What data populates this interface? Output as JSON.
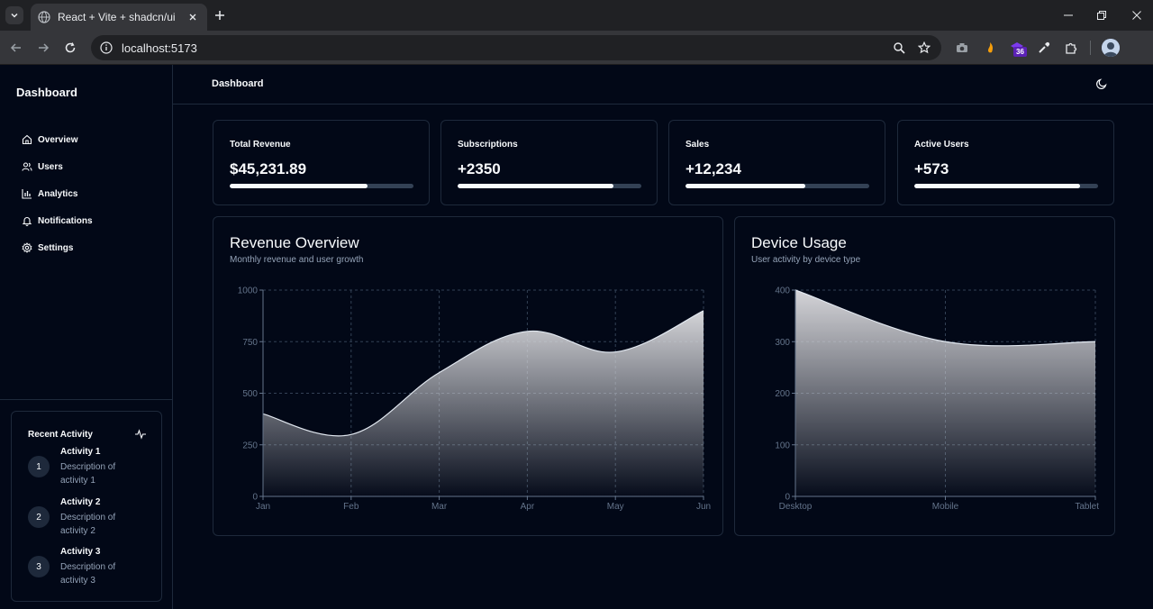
{
  "browser": {
    "tab_title": "React + Vite + shadcn/ui",
    "url": "localhost:5173",
    "extension_badge": "36"
  },
  "sidebar": {
    "title": "Dashboard",
    "items": [
      {
        "label": "Overview",
        "icon": "home-icon"
      },
      {
        "label": "Users",
        "icon": "users-icon"
      },
      {
        "label": "Analytics",
        "icon": "bar-chart-icon"
      },
      {
        "label": "Notifications",
        "icon": "bell-icon"
      },
      {
        "label": "Settings",
        "icon": "gear-icon"
      }
    ],
    "activity": {
      "title": "Recent Activity",
      "items": [
        {
          "num": "1",
          "name": "Activity 1",
          "desc": "Description of activity 1"
        },
        {
          "num": "2",
          "name": "Activity 2",
          "desc": "Description of activity 2"
        },
        {
          "num": "3",
          "name": "Activity 3",
          "desc": "Description of activity 3"
        }
      ]
    }
  },
  "header": {
    "title": "Dashboard"
  },
  "stats": [
    {
      "label": "Total Revenue",
      "value": "$45,231.89",
      "progress": 0.75
    },
    {
      "label": "Subscriptions",
      "value": "+2350",
      "progress": 0.85
    },
    {
      "label": "Sales",
      "value": "+12,234",
      "progress": 0.65
    },
    {
      "label": "Active Users",
      "value": "+573",
      "progress": 0.9
    }
  ],
  "revenue_card": {
    "title": "Revenue Overview",
    "subtitle": "Monthly revenue and user growth"
  },
  "device_card": {
    "title": "Device Usage",
    "subtitle": "User activity by device type"
  },
  "colors": {
    "background": "#020817",
    "border": "#1e293b",
    "muted": "#94a3b8",
    "foreground": "#f8fafc"
  },
  "chart_data": [
    {
      "type": "area",
      "categories": [
        "Jan",
        "Feb",
        "Mar",
        "Apr",
        "May",
        "Jun"
      ],
      "series": [
        {
          "values": [
            400,
            300,
            600,
            800,
            700,
            900
          ]
        }
      ],
      "yticks": [
        0,
        250,
        500,
        750,
        1000
      ],
      "ylim": [
        0,
        1000
      ],
      "grid": true
    },
    {
      "type": "area",
      "categories": [
        "Desktop",
        "Mobile",
        "Tablet"
      ],
      "series": [
        {
          "values": [
            400,
            300,
            300
          ]
        }
      ],
      "yticks": [
        0,
        100,
        200,
        300,
        400
      ],
      "ylim": [
        0,
        400
      ],
      "grid": true
    }
  ]
}
